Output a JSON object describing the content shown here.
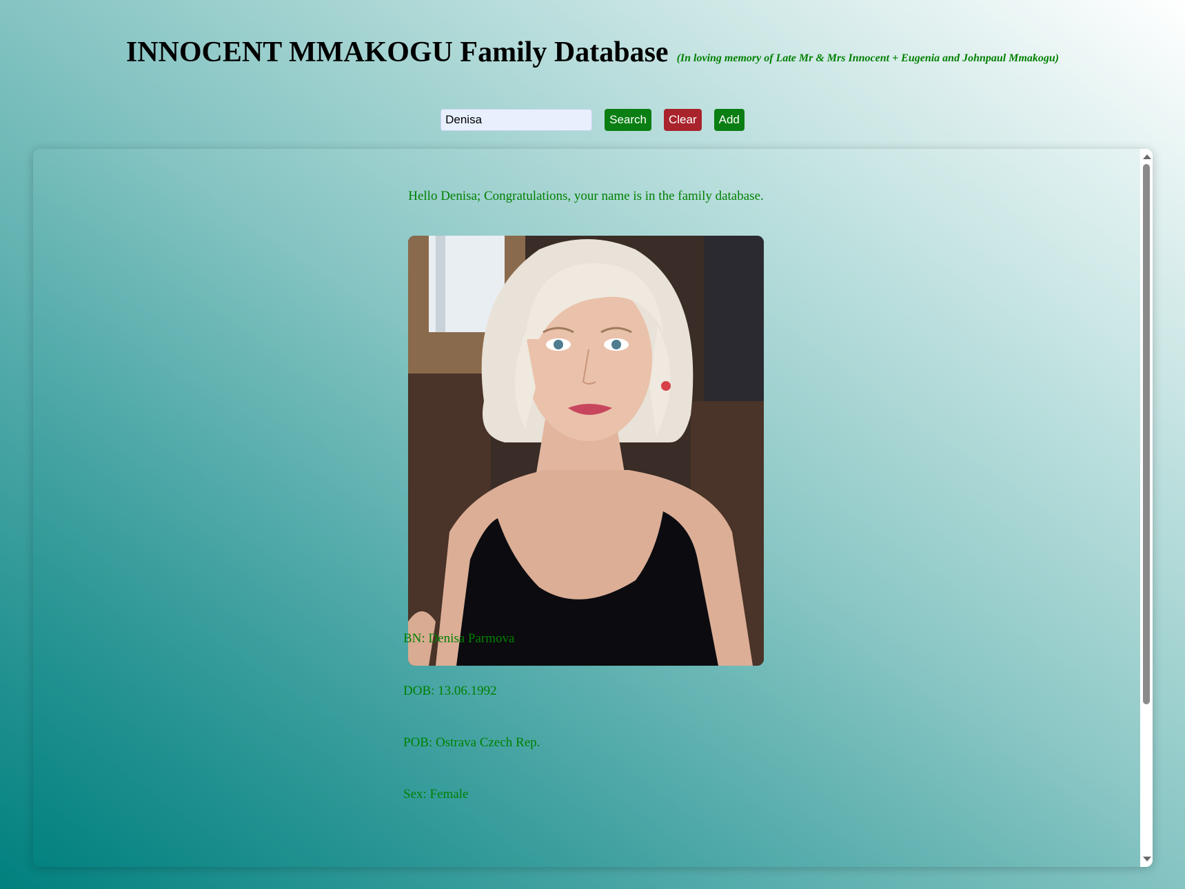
{
  "header": {
    "title": "INNOCENT MMAKOGU Family Database",
    "subtitle": "(In loving memory of Late Mr & Mrs Innocent + Eugenia and Johnpaul Mmakogu)"
  },
  "search": {
    "value": "Denisa",
    "search_label": "Search",
    "clear_label": "Clear",
    "add_label": "Add"
  },
  "result": {
    "greeting": "Hello Denisa; Congratulations, your name is in the family database.",
    "photo_alt": "Photo of Denisa Parmova",
    "fields": {
      "bn": "BN: Denisa Parmova",
      "dob": "DOB: 13.06.1992",
      "pob": "POB: Ostrava Czech Rep.",
      "sex": "Sex: Female"
    }
  },
  "colors": {
    "accent_green": "#008000",
    "button_green": "#0a7e12",
    "button_red": "#a8232b",
    "background_teal": "#00807f"
  },
  "icons": {
    "scroll_up": "scroll-up-arrow-icon",
    "scroll_down": "scroll-down-arrow-icon"
  }
}
